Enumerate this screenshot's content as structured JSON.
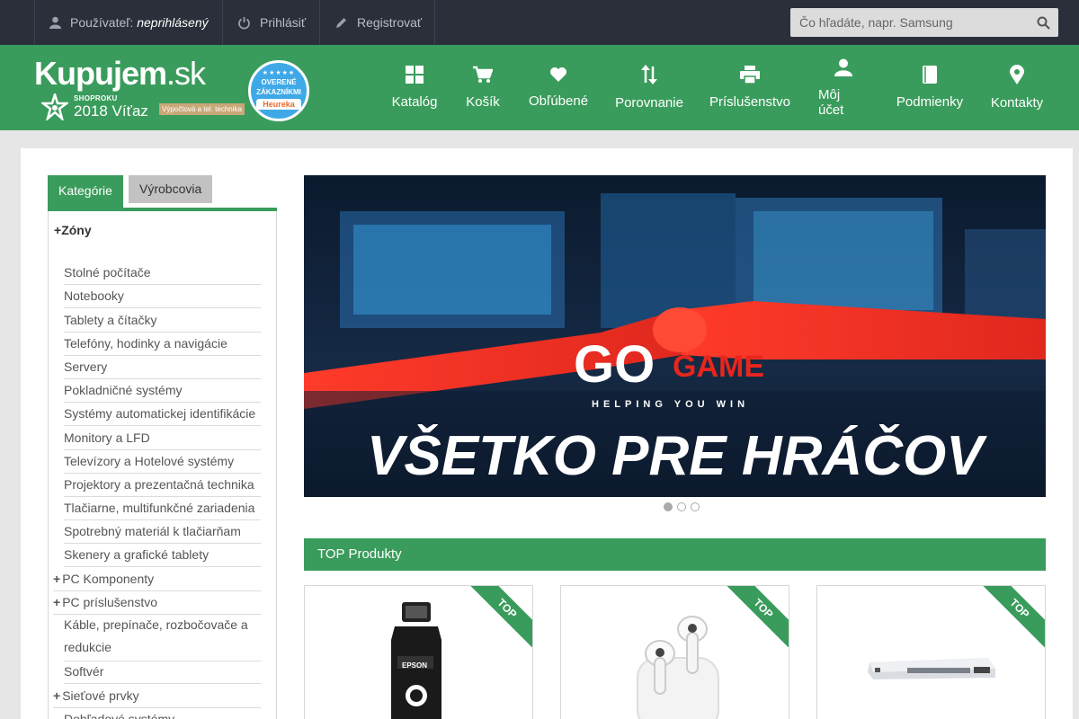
{
  "topbar": {
    "user_label": "Používateľ:",
    "user_status": "neprihlásený",
    "login_label": "Prihlásiť",
    "register_label": "Registrovať",
    "search_placeholder": "Čo hľadáte, napr. Samsung"
  },
  "header": {
    "logo_name": "Kupujem",
    "logo_domain": ".sk",
    "award_small": "SHOPROKU",
    "award_text": "2018 Víťaz",
    "award_category": "Výpočtová a tel. technika",
    "badge_line1": "OVERENÉ",
    "badge_line2": "ZÁKAZNÍKMI",
    "badge_brand": "Heureka",
    "accent_color": "#3a9c5c"
  },
  "nav": [
    {
      "label": "Katalóg",
      "icon": "grid-icon"
    },
    {
      "label": "Košík",
      "icon": "cart-icon"
    },
    {
      "label": "Obľúbené",
      "icon": "heart-icon"
    },
    {
      "label": "Porovnanie",
      "icon": "compare-icon"
    },
    {
      "label": "Príslušenstvo",
      "icon": "printer-icon"
    },
    {
      "label": "Môj účet",
      "icon": "user-icon"
    },
    {
      "label": "Podmienky",
      "icon": "book-icon"
    },
    {
      "label": "Kontakty",
      "icon": "location-icon"
    }
  ],
  "sidebar": {
    "tab_categories": "Kategórie",
    "tab_manufacturers": "Výrobcovia",
    "zone_heading": "Zóny",
    "items": [
      {
        "label": "Stolné počítače"
      },
      {
        "label": "Notebooky"
      },
      {
        "label": "Tablety a čítačky"
      },
      {
        "label": "Telefóny, hodinky a navigácie"
      },
      {
        "label": "Servery"
      },
      {
        "label": "Pokladničné systémy"
      },
      {
        "label": "Systémy automatickej identifikácie"
      },
      {
        "label": "Monitory a LFD"
      },
      {
        "label": "Televízory a Hotelové systémy"
      },
      {
        "label": "Projektory a prezentačná technika"
      },
      {
        "label": "Tlačiarne, multifunkčné zariadenia"
      },
      {
        "label": "Spotrebný materiál k tlačiarňam"
      },
      {
        "label": "Skenery a grafické tablety"
      },
      {
        "label": "PC Komponenty"
      },
      {
        "label": "PC príslušenstvo"
      },
      {
        "label": "Káble, prepínače, rozbočovače a redukcie"
      },
      {
        "label": "Softvér"
      },
      {
        "label": "Sieťové prvky"
      },
      {
        "label": "Dohľadové systémy"
      }
    ]
  },
  "banner": {
    "brand_go": "GO",
    "brand_game": "GAME",
    "tagline": "HELPING YOU WIN",
    "headline": "VŠETKO PRE HRÁČOV",
    "slide_count": 3,
    "active_slide": 1
  },
  "products": {
    "section_title": "TOP Produkty",
    "ribbon": "TOP",
    "items": [
      {
        "name": "Epson ink bottle",
        "image": "ink-bottle-image"
      },
      {
        "name": "Wireless earbuds",
        "image": "earbuds-image"
      },
      {
        "name": "Network switch",
        "image": "switch-image"
      }
    ]
  }
}
